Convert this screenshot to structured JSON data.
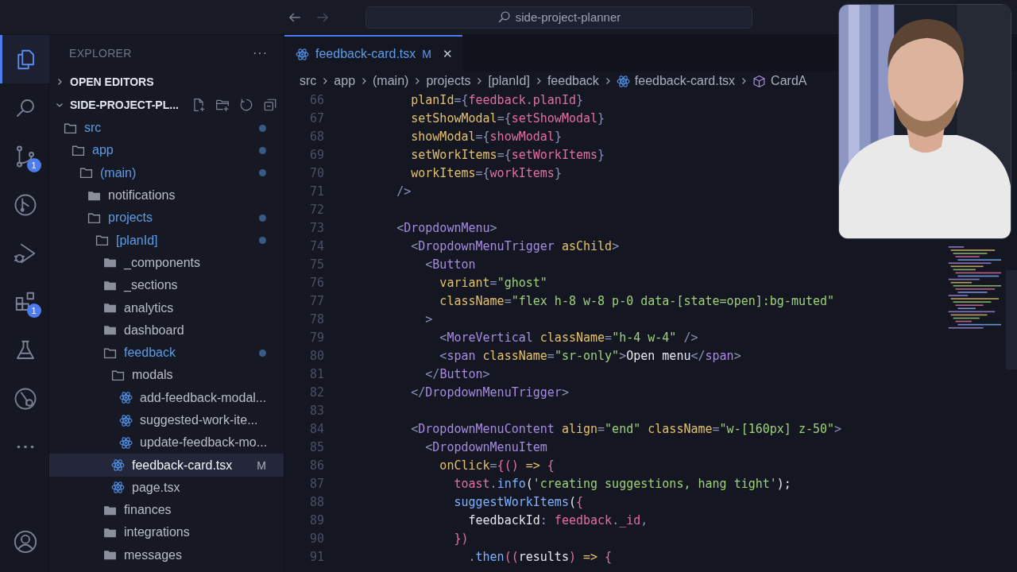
{
  "title_bar": {
    "search": {
      "value": "side-project-planner"
    }
  },
  "activity_bar": {
    "items": [
      {
        "kind": "explorer",
        "selected": true
      },
      {
        "kind": "search",
        "selected": false
      },
      {
        "kind": "source-control",
        "selected": false,
        "badge": "1"
      },
      {
        "kind": "git-graph",
        "selected": false
      },
      {
        "kind": "run-debug",
        "selected": false
      },
      {
        "kind": "extensions",
        "selected": false,
        "badge": "1"
      },
      {
        "kind": "testing",
        "selected": false
      },
      {
        "kind": "remote",
        "selected": false
      },
      {
        "kind": "more",
        "selected": false
      }
    ],
    "account": {
      "kind": "account",
      "selected": false
    }
  },
  "sidebar": {
    "title": "EXPLORER",
    "more": "···",
    "sections": [
      {
        "label": "OPEN EDITORS",
        "expanded": false
      },
      {
        "label": "SIDE-PROJECT-PL...",
        "expanded": true
      }
    ],
    "tree": [
      {
        "name": "src",
        "kind": "folder",
        "expanded": true,
        "modified": true,
        "selected": false,
        "children": [
          {
            "name": "app",
            "kind": "folder",
            "expanded": true,
            "modified": true,
            "selected": false,
            "children": [
              {
                "name": "(main)",
                "kind": "folder",
                "expanded": true,
                "modified": true,
                "selected": false,
                "children": [
                  {
                    "name": "notifications",
                    "kind": "folder",
                    "expanded": false,
                    "modified": false,
                    "selected": false
                  },
                  {
                    "name": "projects",
                    "kind": "folder",
                    "expanded": true,
                    "modified": true,
                    "selected": false,
                    "children": [
                      {
                        "name": "[planId]",
                        "kind": "folder",
                        "expanded": true,
                        "modified": true,
                        "selected": false,
                        "children": [
                          {
                            "name": "_components",
                            "kind": "folder",
                            "expanded": false,
                            "modified": false,
                            "selected": false
                          },
                          {
                            "name": "_sections",
                            "kind": "folder",
                            "expanded": false,
                            "modified": false,
                            "selected": false
                          },
                          {
                            "name": "analytics",
                            "kind": "folder",
                            "expanded": false,
                            "modified": false,
                            "selected": false
                          },
                          {
                            "name": "dashboard",
                            "kind": "folder",
                            "expanded": false,
                            "modified": false,
                            "selected": false
                          },
                          {
                            "name": "feedback",
                            "kind": "folder",
                            "expanded": true,
                            "modified": true,
                            "selected": false,
                            "children": [
                              {
                                "name": "modals",
                                "kind": "folder",
                                "expanded": true,
                                "modified": false,
                                "selected": false,
                                "children": [
                                  {
                                    "name": "add-feedback-modal...",
                                    "kind": "file",
                                    "selected": false
                                  },
                                  {
                                    "name": "suggested-work-ite...",
                                    "kind": "file",
                                    "selected": false
                                  },
                                  {
                                    "name": "update-feedback-mo...",
                                    "kind": "file",
                                    "selected": false
                                  }
                                ]
                              },
                              {
                                "name": "feedback-card.tsx",
                                "kind": "file",
                                "selected": true,
                                "badge": "M"
                              },
                              {
                                "name": "page.tsx",
                                "kind": "file",
                                "selected": false
                              }
                            ]
                          },
                          {
                            "name": "finances",
                            "kind": "folder",
                            "expanded": false,
                            "modified": false,
                            "selected": false
                          },
                          {
                            "name": "integrations",
                            "kind": "folder",
                            "expanded": false,
                            "modified": false,
                            "selected": false
                          },
                          {
                            "name": "messages",
                            "kind": "folder",
                            "expanded": false,
                            "modified": false,
                            "selected": false
                          }
                        ]
                      }
                    ]
                  }
                ]
              }
            ]
          }
        ]
      }
    ]
  },
  "editor": {
    "tabs": [
      {
        "label": "feedback-card.tsx",
        "badge": "M",
        "selected": true,
        "close": "✕"
      }
    ],
    "breadcrumb": [
      {
        "label": "src",
        "kind": "folder"
      },
      {
        "label": "app",
        "kind": "folder"
      },
      {
        "label": "(main)",
        "kind": "folder"
      },
      {
        "label": "projects",
        "kind": "folder"
      },
      {
        "label": "[planId]",
        "kind": "folder"
      },
      {
        "label": "feedback",
        "kind": "folder"
      },
      {
        "label": "feedback-card.tsx",
        "kind": "file"
      },
      {
        "label": "CardA",
        "kind": "symbol"
      }
    ],
    "lines": [
      {
        "number": "66",
        "tokens": [
          {
            "kind": "attr",
            "text": "        planId"
          },
          {
            "kind": "punct",
            "text": "={"
          },
          {
            "kind": "variable",
            "text": "feedback"
          },
          {
            "kind": "punct",
            "text": "."
          },
          {
            "kind": "variable",
            "text": "planId"
          },
          {
            "kind": "punct",
            "text": "}"
          }
        ]
      },
      {
        "number": "67",
        "tokens": [
          {
            "kind": "attr",
            "text": "        setShowModal"
          },
          {
            "kind": "punct",
            "text": "={"
          },
          {
            "kind": "variable",
            "text": "setShowModal"
          },
          {
            "kind": "punct",
            "text": "}"
          }
        ]
      },
      {
        "number": "68",
        "tokens": [
          {
            "kind": "attr",
            "text": "        showModal"
          },
          {
            "kind": "punct",
            "text": "={"
          },
          {
            "kind": "variable",
            "text": "showModal"
          },
          {
            "kind": "punct",
            "text": "}"
          }
        ]
      },
      {
        "number": "69",
        "tokens": [
          {
            "kind": "attr",
            "text": "        setWorkItems"
          },
          {
            "kind": "punct",
            "text": "={"
          },
          {
            "kind": "variable",
            "text": "setWorkItems"
          },
          {
            "kind": "punct",
            "text": "}"
          }
        ]
      },
      {
        "number": "70",
        "tokens": [
          {
            "kind": "attr",
            "text": "        workItems"
          },
          {
            "kind": "punct",
            "text": "={"
          },
          {
            "kind": "variable",
            "text": "workItems"
          },
          {
            "kind": "punct",
            "text": "}"
          }
        ]
      },
      {
        "number": "71",
        "tokens": [
          {
            "kind": "punct",
            "text": "      />"
          }
        ]
      },
      {
        "number": "72"
      },
      {
        "number": "73",
        "tokens": [
          {
            "kind": "punct",
            "text": "      <"
          },
          {
            "kind": "tag",
            "text": "DropdownMenu"
          },
          {
            "kind": "punct",
            "text": ">"
          }
        ]
      },
      {
        "number": "74",
        "tokens": [
          {
            "kind": "punct",
            "text": "        <"
          },
          {
            "kind": "tag",
            "text": "DropdownMenuTrigger"
          },
          {
            "kind": "attr",
            "text": " asChild"
          },
          {
            "kind": "punct",
            "text": ">"
          }
        ]
      },
      {
        "number": "75",
        "tokens": [
          {
            "kind": "punct",
            "text": "          <"
          },
          {
            "kind": "tag",
            "text": "Button"
          }
        ]
      },
      {
        "number": "76",
        "tokens": [
          {
            "kind": "attr",
            "text": "            variant"
          },
          {
            "kind": "punct",
            "text": "="
          },
          {
            "kind": "string",
            "text": "\"ghost\""
          }
        ]
      },
      {
        "number": "77",
        "tokens": [
          {
            "kind": "attr",
            "text": "            className"
          },
          {
            "kind": "punct",
            "text": "="
          },
          {
            "kind": "string",
            "text": "\"flex h-8 w-8 p-0 data-[state=open]:bg-muted\""
          }
        ]
      },
      {
        "number": "78",
        "tokens": [
          {
            "kind": "punct",
            "text": "          >"
          }
        ]
      },
      {
        "number": "79",
        "tokens": [
          {
            "kind": "punct",
            "text": "            <"
          },
          {
            "kind": "tag",
            "text": "MoreVertical"
          },
          {
            "kind": "attr",
            "text": " className"
          },
          {
            "kind": "punct",
            "text": "="
          },
          {
            "kind": "string",
            "text": "\"h-4 w-4\""
          },
          {
            "kind": "punct",
            "text": " />"
          }
        ]
      },
      {
        "number": "80",
        "tokens": [
          {
            "kind": "punct",
            "text": "            <"
          },
          {
            "kind": "tag",
            "text": "span"
          },
          {
            "kind": "attr",
            "text": " className"
          },
          {
            "kind": "punct",
            "text": "="
          },
          {
            "kind": "string",
            "text": "\"sr-only\""
          },
          {
            "kind": "punct",
            "text": ">"
          },
          {
            "kind": "text",
            "text": "Open menu"
          },
          {
            "kind": "punct",
            "text": "</"
          },
          {
            "kind": "tag",
            "text": "span"
          },
          {
            "kind": "punct",
            "text": ">"
          }
        ]
      },
      {
        "number": "81",
        "tokens": [
          {
            "kind": "punct",
            "text": "          </"
          },
          {
            "kind": "tag",
            "text": "Button"
          },
          {
            "kind": "punct",
            "text": ">"
          }
        ]
      },
      {
        "number": "82",
        "tokens": [
          {
            "kind": "punct",
            "text": "        </"
          },
          {
            "kind": "tag",
            "text": "DropdownMenuTrigger"
          },
          {
            "kind": "punct",
            "text": ">"
          }
        ]
      },
      {
        "number": "83"
      },
      {
        "number": "84",
        "tokens": [
          {
            "kind": "punct",
            "text": "        <"
          },
          {
            "kind": "tag",
            "text": "DropdownMenuContent"
          },
          {
            "kind": "attr",
            "text": " align"
          },
          {
            "kind": "punct",
            "text": "="
          },
          {
            "kind": "string",
            "text": "\"end\""
          },
          {
            "kind": "attr",
            "text": " className"
          },
          {
            "kind": "punct",
            "text": "="
          },
          {
            "kind": "string",
            "text": "\"w-[160px] z-50\""
          },
          {
            "kind": "punct",
            "text": ">"
          }
        ]
      },
      {
        "number": "85",
        "tokens": [
          {
            "kind": "punct",
            "text": "          <"
          },
          {
            "kind": "tag",
            "text": "DropdownMenuItem"
          }
        ]
      },
      {
        "number": "86",
        "tokens": [
          {
            "kind": "attr",
            "text": "            onClick"
          },
          {
            "kind": "punct",
            "text": "="
          },
          {
            "kind": "variable",
            "text": "{()"
          },
          {
            "kind": "attr",
            "text": " =>"
          },
          {
            "kind": "variable",
            "text": " {"
          }
        ]
      },
      {
        "number": "87",
        "tokens": [
          {
            "kind": "variable",
            "text": "              toast"
          },
          {
            "kind": "punct",
            "text": "."
          },
          {
            "kind": "function",
            "text": "info"
          },
          {
            "kind": "text",
            "text": "("
          },
          {
            "kind": "string",
            "text": "'creating suggestions, hang tight'"
          },
          {
            "kind": "text",
            "text": ");"
          }
        ]
      },
      {
        "number": "88",
        "tokens": [
          {
            "kind": "function",
            "text": "              suggestWorkItems"
          },
          {
            "kind": "text",
            "text": "("
          },
          {
            "kind": "variable",
            "text": "{"
          }
        ]
      },
      {
        "number": "89",
        "tokens": [
          {
            "kind": "text",
            "text": "                feedbackId"
          },
          {
            "kind": "punct",
            "text": ":"
          },
          {
            "kind": "variable",
            "text": " feedback"
          },
          {
            "kind": "punct",
            "text": "."
          },
          {
            "kind": "variable",
            "text": "_id"
          },
          {
            "kind": "punct",
            "text": ","
          }
        ]
      },
      {
        "number": "90",
        "tokens": [
          {
            "kind": "variable",
            "text": "              })"
          }
        ]
      },
      {
        "number": "91",
        "tokens": [
          {
            "kind": "punct",
            "text": "                ."
          },
          {
            "kind": "function",
            "text": "then"
          },
          {
            "kind": "variable",
            "text": "(("
          },
          {
            "kind": "text",
            "text": "results"
          },
          {
            "kind": "variable",
            "text": ")"
          },
          {
            "kind": "attr",
            "text": " =>"
          },
          {
            "kind": "variable",
            "text": " {"
          }
        ]
      }
    ]
  }
}
